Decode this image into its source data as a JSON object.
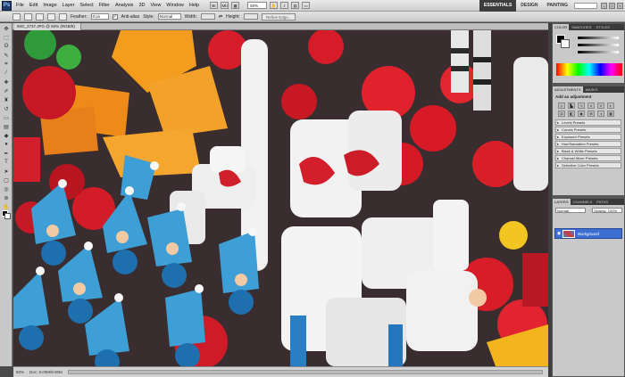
{
  "app": {
    "logo": "Ps"
  },
  "menu": [
    "File",
    "Edit",
    "Image",
    "Layer",
    "Select",
    "Filter",
    "Analysis",
    "3D",
    "View",
    "Window",
    "Help"
  ],
  "menubar": {
    "zoom": "50%"
  },
  "workspaces": [
    "ESSENTIALS",
    "DESIGN",
    "PAINTING"
  ],
  "options": {
    "feather_label": "Feather:",
    "feather_value": "0 px",
    "antialias_label": "Anti-alias",
    "style_label": "Style:",
    "style_value": "Normal",
    "width_label": "Width:",
    "height_label": "Height:",
    "refine_edge": "Refine Edge..."
  },
  "document": {
    "tab_title": "IMG_3737.JPG @ 50% (RGB/8)",
    "zoom": "50%",
    "doc_info": "Doc: 8.00M/8.00M"
  },
  "panels": {
    "color_tabs": [
      "COLOR",
      "SWATCHES",
      "STYLES"
    ],
    "adj_tabs": [
      "ADJUSTMENTS",
      "MASKS"
    ],
    "adj_title": "Add an adjustment",
    "presets": [
      "Levels Presets",
      "Curves Presets",
      "Exposure Presets",
      "Hue/Saturation Presets",
      "Black & White Presets",
      "Channel Mixer Presets",
      "Selective Color Presets"
    ],
    "layers_tabs": [
      "LAYERS",
      "CHANNELS",
      "PATHS"
    ],
    "blend_mode": "Normal",
    "opacity": "Opacity: 100%",
    "layer_name": "Background"
  },
  "colors": {
    "accent": "#3c6fd1"
  }
}
